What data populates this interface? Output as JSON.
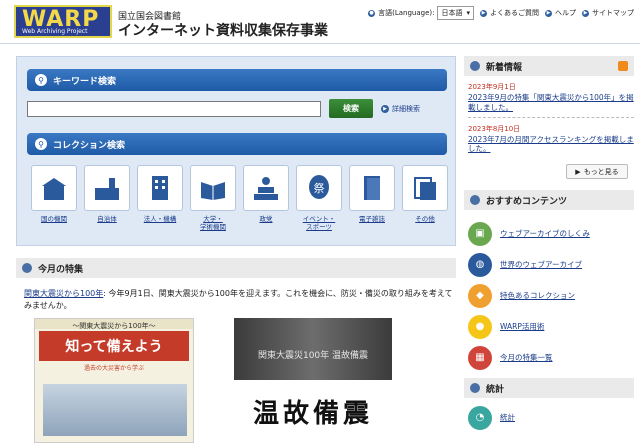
{
  "header": {
    "logo_text": "WARP",
    "logo_sub": "Web Archiving Project",
    "org": "国立国会図書館",
    "project": "インターネット資料収集保存事業",
    "language_label": "言語(Language):",
    "language_value": "日本語",
    "faq": "よくあるご質問",
    "help": "ヘルプ",
    "sitemap": "サイトマップ"
  },
  "keyword": {
    "heading": "キーワード検索",
    "button": "検索",
    "advanced": "詳細検索"
  },
  "collection": {
    "heading": "コレクション検索",
    "items": [
      {
        "label": "国の機関",
        "icon": "government-building"
      },
      {
        "label": "自治体",
        "icon": "local-government"
      },
      {
        "label": "法人・機構",
        "icon": "office-building"
      },
      {
        "label": "大学・\n学術機関",
        "icon": "university"
      },
      {
        "label": "政党",
        "icon": "political-party"
      },
      {
        "label": "イベント・\nスポーツ",
        "icon": "festival"
      },
      {
        "label": "電子雑誌",
        "icon": "magazine"
      },
      {
        "label": "その他",
        "icon": "other"
      }
    ]
  },
  "feature": {
    "heading": "今月の特集",
    "link": "関東大震災から100年",
    "text": ": 今年9月1日、関東大震災から100年を迎えます。これを機会に、防災・備災の取り組みを考えてみませんか。",
    "thumb1_head": "～関東大震災から100年～",
    "thumb1_title": "知って備えよう",
    "thumb1_sub": "過去の大災害から学ぶ",
    "thumb2_title": "関東大震災100年 温故備震",
    "thumb2_bottom": "温故備震"
  },
  "news": {
    "heading": "新着情報",
    "items": [
      {
        "date": "2023年9月1日",
        "text": "2023年9月の特集「関東大震災から100年」を掲載しました。"
      },
      {
        "date": "2023年8月10日",
        "text": "2023年7月の月間アクセスランキングを掲載しました。"
      }
    ],
    "more": "もっと見る"
  },
  "recommend": {
    "heading": "おすすめコンテンツ",
    "items": [
      {
        "label": "ウェブアーカイブのしくみ",
        "icon": "robot",
        "color": "#6aa84f"
      },
      {
        "label": "世界のウェブアーカイブ",
        "icon": "globe",
        "color": "#2b5a9c"
      },
      {
        "label": "特色あるコレクション",
        "icon": "box",
        "color": "#f0a030"
      },
      {
        "label": "WARP活用術",
        "icon": "lightbulb",
        "color": "#f5c518"
      },
      {
        "label": "今月の特集一覧",
        "icon": "calendar",
        "color": "#d0453a"
      }
    ]
  },
  "stats": {
    "heading": "統計",
    "link": "統計"
  }
}
